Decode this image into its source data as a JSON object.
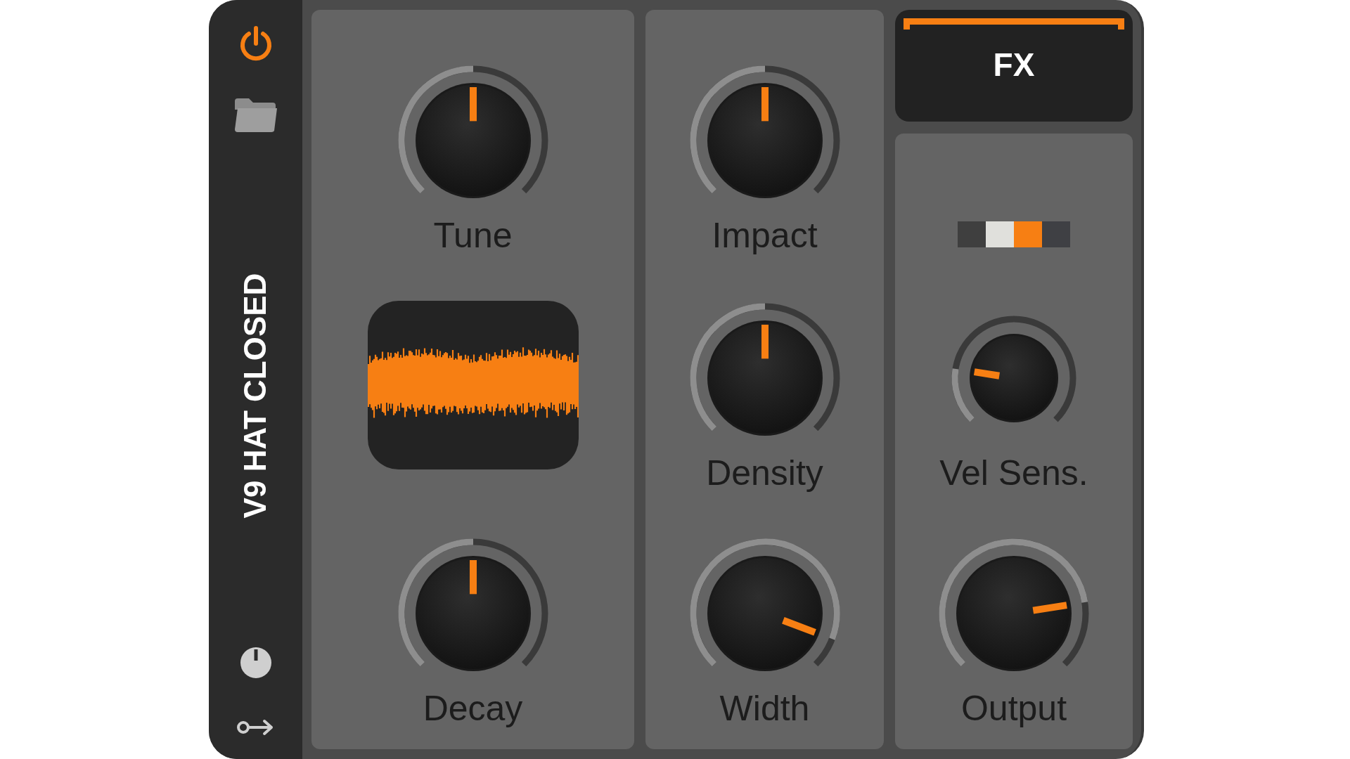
{
  "sidebar": {
    "power": {
      "on": true
    },
    "title": "V9 HAT CLOSED"
  },
  "columns": [
    {
      "items": [
        {
          "kind": "knob",
          "label": "Tune"
        },
        {
          "kind": "waveform"
        },
        {
          "kind": "knob",
          "label": "Decay"
        }
      ]
    },
    {
      "items": [
        {
          "kind": "knob",
          "label": "Impact"
        },
        {
          "kind": "knob",
          "label": "Density"
        },
        {
          "kind": "knob",
          "label": "Width"
        }
      ]
    },
    {
      "fx_button": {
        "label": "FX",
        "on": true
      },
      "items": [
        {
          "kind": "selector",
          "segments": [
            {
              "color": "#3f3f3f"
            },
            {
              "color": "#e0e0dc"
            },
            {
              "color": "#f77f13"
            },
            {
              "color": "#3f4044"
            }
          ]
        },
        {
          "kind": "knob",
          "label": "Vel Sens."
        },
        {
          "kind": "knob",
          "label": "Output"
        }
      ]
    }
  ]
}
